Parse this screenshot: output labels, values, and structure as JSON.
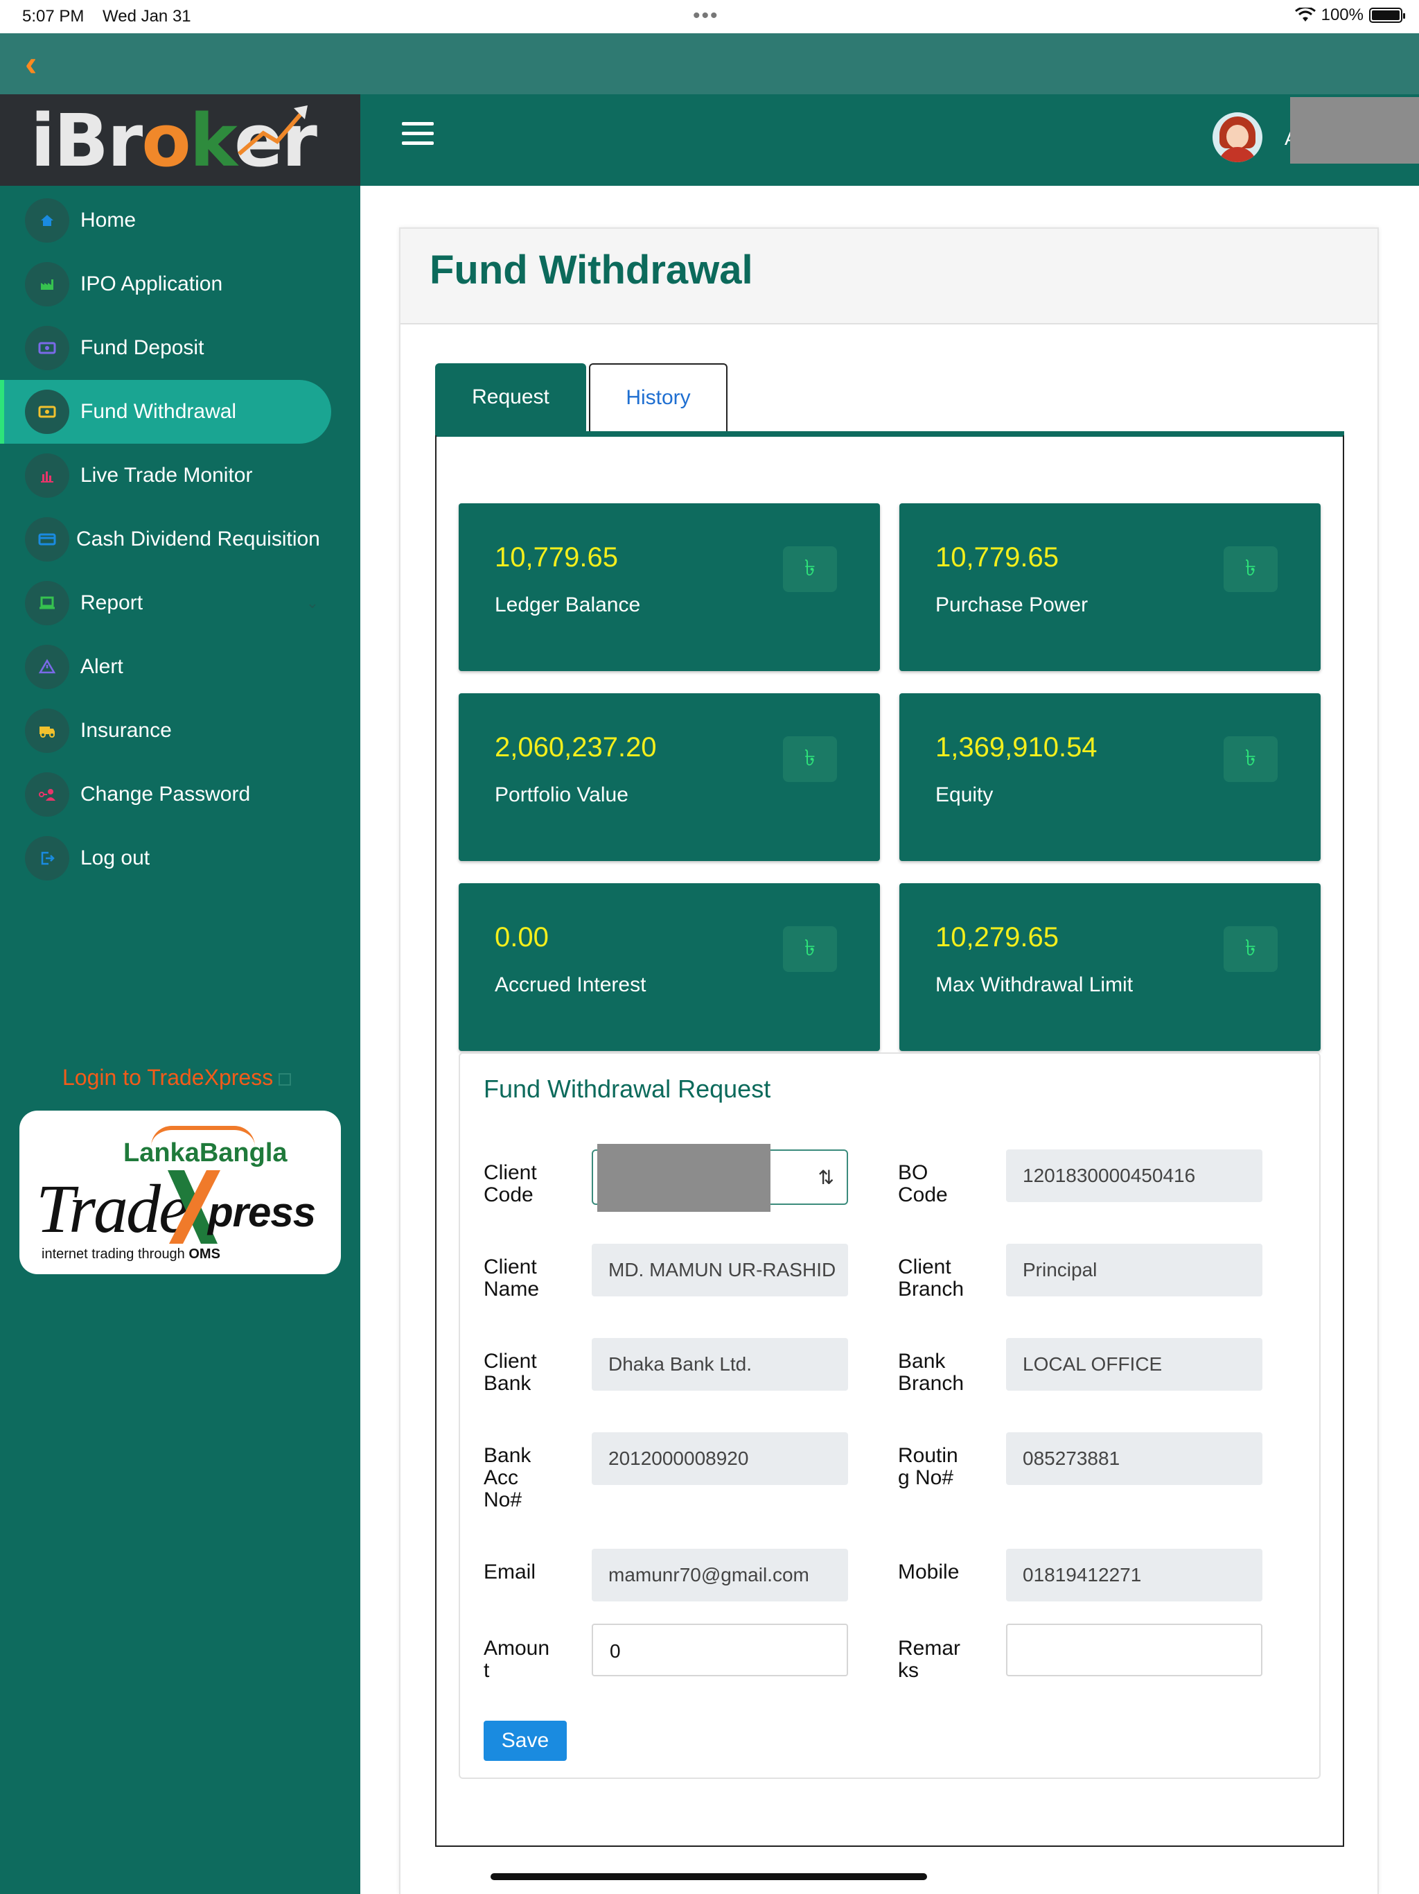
{
  "status_bar": {
    "time": "5:07 PM",
    "date": "Wed Jan 31",
    "battery": "100%"
  },
  "logo": {
    "text_i": "i",
    "text_br": "Br",
    "text_o": "o",
    "text_k": "k",
    "text_er": "er"
  },
  "sidebar": {
    "items": [
      {
        "label": "Home",
        "icon": "home-icon",
        "color": "#1a8be0"
      },
      {
        "label": "IPO Application",
        "icon": "factory-icon",
        "color": "#36c24f"
      },
      {
        "label": "Fund Deposit",
        "icon": "money-icon",
        "color": "#7a6ae8"
      },
      {
        "label": "Fund Withdrawal",
        "icon": "cash-icon",
        "color": "#f2c12e",
        "active": true
      },
      {
        "label": "Live Trade Monitor",
        "icon": "bar-chart-icon",
        "color": "#e8356a"
      },
      {
        "label": "Cash Dividend Requisition",
        "icon": "card-icon",
        "color": "#1a8be0"
      },
      {
        "label": "Report",
        "icon": "laptop-icon",
        "color": "#36c24f"
      },
      {
        "label": "Alert",
        "icon": "warning-icon",
        "color": "#7a6ae8"
      },
      {
        "label": "Insurance",
        "icon": "ambulance-icon",
        "color": "#f2c12e"
      },
      {
        "label": "Change Password",
        "icon": "user-key-icon",
        "color": "#e8356a"
      },
      {
        "label": "Log out",
        "icon": "logout-icon",
        "color": "#1a8be0"
      }
    ],
    "tradexpress_link": "Login to TradeXpress",
    "tradexpress_logo": {
      "lanka": "LankaBangla",
      "trade": "Trade",
      "press": "press",
      "sub_a": "internet trading through",
      "sub_b": "OMS"
    }
  },
  "header": {
    "user_initial": "A"
  },
  "page": {
    "title": "Fund Withdrawal",
    "tabs": [
      {
        "label": "Request"
      },
      {
        "label": "History"
      }
    ]
  },
  "stats": [
    {
      "value": "10,779.65",
      "label": "Ledger Balance",
      "currency": "৳"
    },
    {
      "value": "10,779.65",
      "label": "Purchase Power",
      "currency": "৳"
    },
    {
      "value": "2,060,237.20",
      "label": "Portfolio Value",
      "currency": "৳"
    },
    {
      "value": "1,369,910.54",
      "label": "Equity",
      "currency": "৳"
    },
    {
      "value": "0.00",
      "label": "Accrued Interest",
      "currency": "৳"
    },
    {
      "value": "10,279.65",
      "label": "Max Withdrawal Limit",
      "currency": "৳"
    }
  ],
  "form": {
    "title": "Fund Withdrawal Request",
    "client_code_label": "Client Code",
    "bo_code_label": "BO Code",
    "bo_code": "1201830000450416",
    "client_name_label": "Client Name",
    "client_name": "MD. MAMUN UR-RASHID",
    "client_branch_label": "Client Branch",
    "client_branch": "Principal",
    "client_bank_label": "Client Bank",
    "client_bank": "Dhaka Bank Ltd.",
    "bank_branch_label": "Bank Branch",
    "bank_branch": "LOCAL OFFICE",
    "bank_acc_label": "Bank Acc No#",
    "bank_acc": "2012000008920",
    "routing_label": "Routin g No#",
    "routing": "085273881",
    "email_label": "Email",
    "email": "mamunr70@gmail.com",
    "mobile_label": "Mobile",
    "mobile": "01819412271",
    "amount_label": "Amoun t",
    "amount": "0",
    "remarks_label": "Remar ks",
    "remarks": "",
    "save_label": "Save"
  }
}
